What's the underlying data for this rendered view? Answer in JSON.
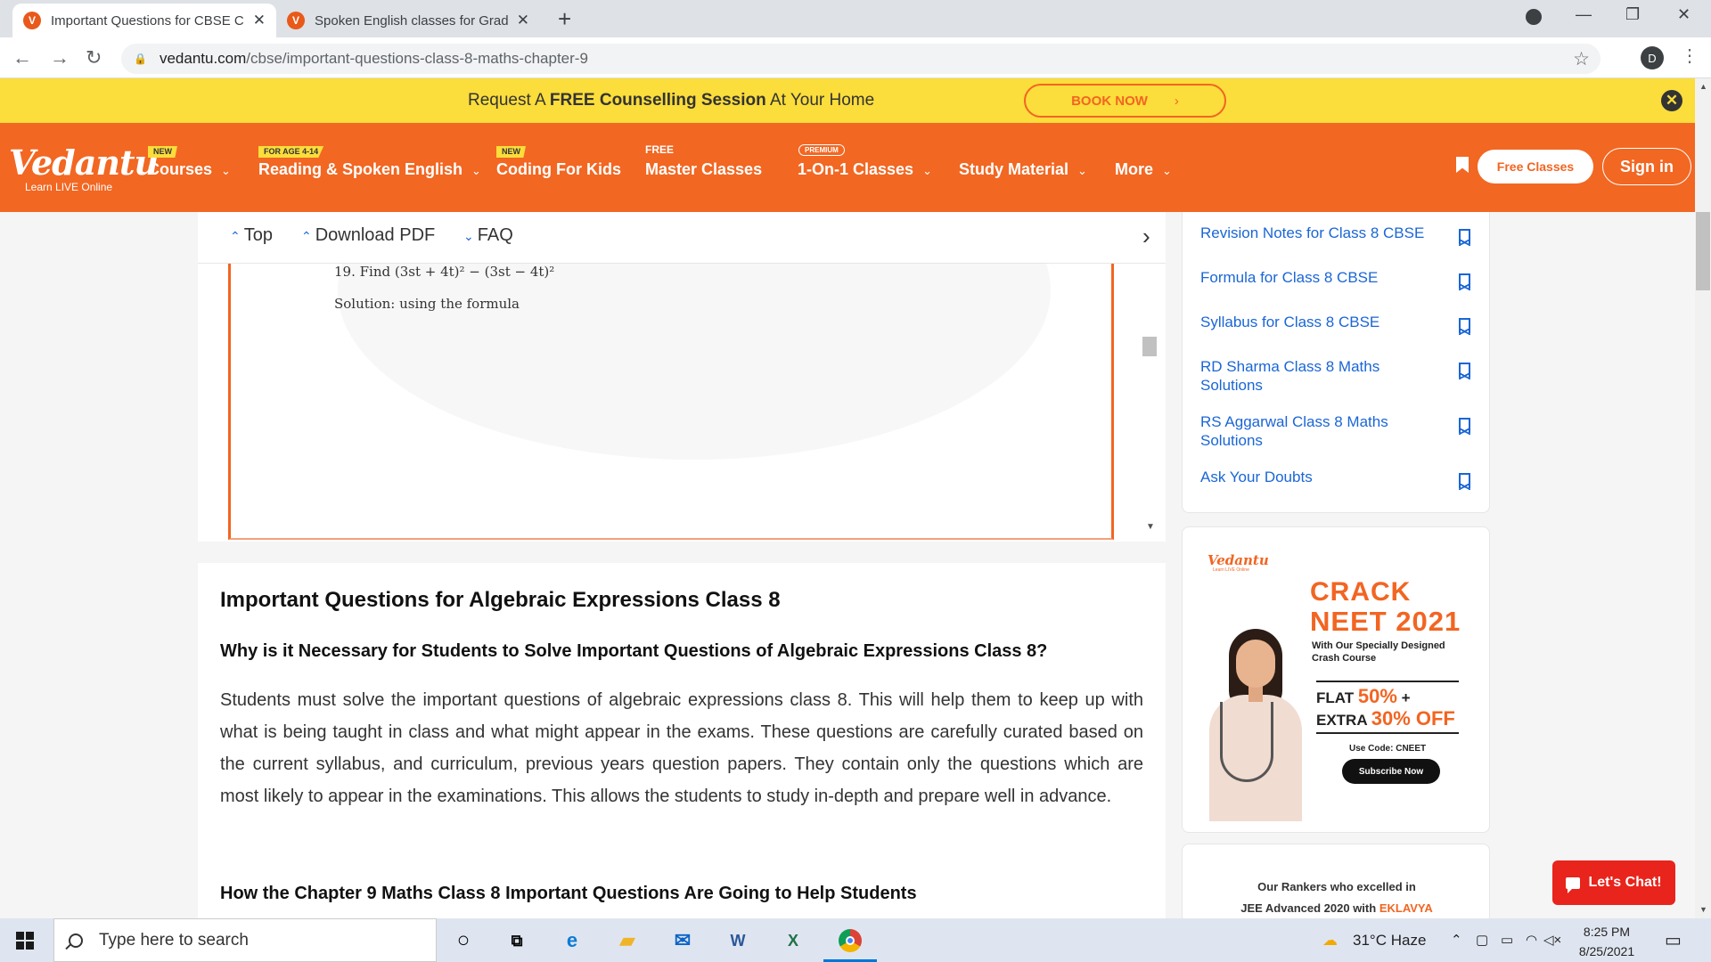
{
  "browser": {
    "tabs": [
      {
        "title": "Important Questions for CBSE Cl",
        "favicon": "V",
        "active": true
      },
      {
        "title": "Spoken English classes for Grade",
        "favicon": "V",
        "active": false
      }
    ],
    "new_tab": "+",
    "profile_initial": "D",
    "url_domain": "vedantu.com",
    "url_path": "/cbse/important-questions-class-8-maths-chapter-9"
  },
  "promo": {
    "text_pre": "Request A ",
    "text_bold": "FREE Counselling Session",
    "text_post": " At Your Home",
    "button": "BOOK NOW",
    "close": "✕"
  },
  "nav": {
    "logo": "Vedantu",
    "logo_sub": "Learn LIVE Online",
    "items": [
      {
        "label": "Courses",
        "tag": "NEW",
        "caret": true
      },
      {
        "label": "Reading & Spoken English",
        "tag": "FOR AGE 4-14",
        "caret": true
      },
      {
        "label": "Coding For Kids",
        "tag": "NEW",
        "caret": false
      },
      {
        "label": "Master Classes",
        "tag": "FREE",
        "caret": false
      },
      {
        "label": "1-On-1 Classes",
        "tag": "PREMIUM",
        "caret": true
      },
      {
        "label": "Study Material",
        "tag": "",
        "caret": true
      },
      {
        "label": "More",
        "tag": "",
        "caret": true
      }
    ],
    "free_classes": "Free Classes",
    "sign_in": "Sign in"
  },
  "subnav": {
    "top": "Top",
    "download": "Download PDF",
    "faq": "FAQ"
  },
  "pdf": {
    "line1": "19. Find (3st + 4t)² − (3st − 4t)²",
    "line2": "Solution: using the formula"
  },
  "article": {
    "heading": "Important Questions for Algebraic Expressions Class 8",
    "subheading": "Why is it Necessary for Students to Solve Important Questions of Algebraic Expressions Class 8?",
    "paragraph": "Students must solve the important questions of algebraic expressions class 8. This will help them to keep up with what is being taught in class and what might appear in the exams. These questions are carefully curated based on the current syllabus, and curriculum, previous years question papers. They contain only the questions which are most likely to appear in the examinations. This allows the students to study in-depth and prepare well in advance.",
    "subheading2": "How the Chapter 9 Maths Class 8 Important Questions Are Going to Help Students"
  },
  "sidebar": {
    "links": [
      "Revision Notes for Class 8 CBSE",
      "Formula for Class 8 CBSE",
      "Syllabus for Class 8 CBSE",
      "RD Sharma Class 8 Maths Solutions",
      "RS Aggarwal Class 8 Maths Solutions",
      "Ask Your Doubts"
    ]
  },
  "ad": {
    "logo": "Vedantu",
    "logo_sub": "Learn LIVE Online",
    "crack": "CRACK",
    "neet": "NEET 2021",
    "sub": "With Our Specially Designed Crash Course",
    "flat": "FLAT ",
    "flat_pct": "50%",
    "plus": " +",
    "extra": "EXTRA ",
    "extra_pct": "30% OFF",
    "code": "Use Code: CNEET",
    "button": "Subscribe Now"
  },
  "rankers": {
    "line1": "Our Rankers who excelled in",
    "line2_pre": "JEE Advanced 2020 with ",
    "line2_brand": "EKLAVYA"
  },
  "chat": "Let's Chat!",
  "taskbar": {
    "search_placeholder": "Type here to search",
    "weather": "31°C  Haze",
    "time": "8:25 PM",
    "date": "8/25/2021"
  },
  "colors": {
    "brand_orange": "#f26722",
    "promo_yellow": "#fbdd3b",
    "link_blue": "#1a66d6",
    "chat_red": "#e8241c"
  }
}
